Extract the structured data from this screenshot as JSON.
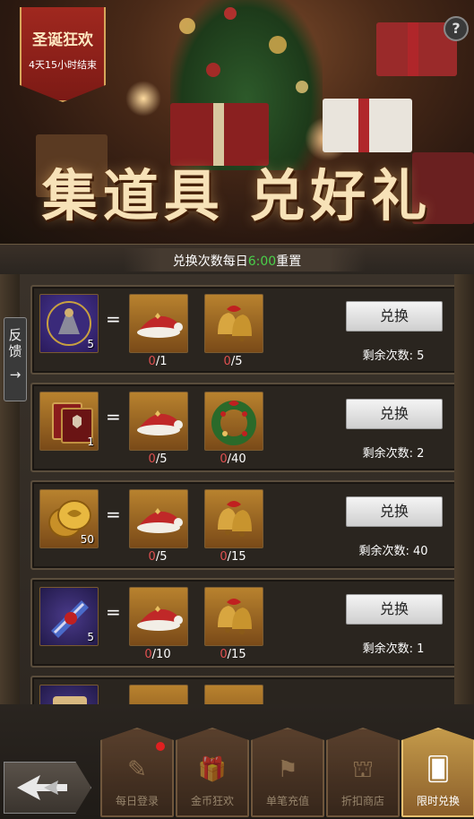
{
  "event": {
    "badge_title": "圣诞狂欢",
    "badge_subtitle": "4天15小时结束",
    "banner_title": "集道具  兑好礼",
    "help_label": "?"
  },
  "reset": {
    "prefix": "兑换次数每日",
    "time": "6:00",
    "suffix": "重置",
    "time_color": "#4ad04a"
  },
  "feedback": {
    "label": "反馈",
    "arrow": "→"
  },
  "rows": [
    {
      "source_icon": "commander-item-icon",
      "source_qty": "5",
      "equals": "=",
      "costs": [
        {
          "icon": "santa-hat-icon",
          "current": "0",
          "required": "/1"
        },
        {
          "icon": "christmas-bells-icon",
          "current": "0",
          "required": "/5"
        }
      ],
      "button": "兑换",
      "remaining_label": "剩余次数:",
      "remaining_value": "5"
    },
    {
      "source_icon": "red-tome-icon",
      "source_qty": "1",
      "equals": "=",
      "costs": [
        {
          "icon": "santa-hat-icon",
          "current": "0",
          "required": "/5"
        },
        {
          "icon": "christmas-wreath-icon",
          "current": "0",
          "required": "/40"
        }
      ],
      "button": "兑换",
      "remaining_label": "剩余次数:",
      "remaining_value": "2"
    },
    {
      "source_icon": "gold-coins-icon",
      "source_qty": "50",
      "equals": "=",
      "costs": [
        {
          "icon": "santa-hat-icon",
          "current": "0",
          "required": "/5"
        },
        {
          "icon": "christmas-bells-icon",
          "current": "0",
          "required": "/15"
        }
      ],
      "button": "兑换",
      "remaining_label": "剩余次数:",
      "remaining_value": "40"
    },
    {
      "source_icon": "scroll-icon",
      "source_qty": "5",
      "equals": "=",
      "costs": [
        {
          "icon": "santa-hat-icon",
          "current": "0",
          "required": "/10"
        },
        {
          "icon": "christmas-bells-icon",
          "current": "0",
          "required": "/15"
        }
      ],
      "button": "兑换",
      "remaining_label": "剩余次数:",
      "remaining_value": "1"
    }
  ],
  "tabs": [
    {
      "label": "每日登录",
      "icon": "quill-icon",
      "active": false,
      "badge": true
    },
    {
      "label": "金币狂欢",
      "icon": "gift-icon",
      "active": false,
      "badge": false
    },
    {
      "label": "单笔充值",
      "icon": "banner-icon",
      "active": false,
      "badge": false
    },
    {
      "label": "折扣商店",
      "icon": "shop-icon",
      "active": false,
      "badge": false
    },
    {
      "label": "限时兑换",
      "icon": "exchange-cards-icon",
      "active": true,
      "badge": false
    }
  ]
}
